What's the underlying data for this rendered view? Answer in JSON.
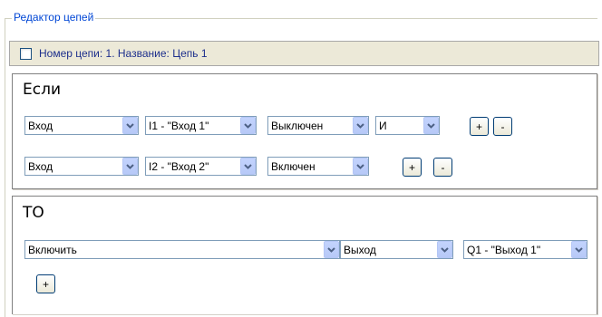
{
  "editor": {
    "title": "Редактор цепей",
    "chain_label": "Номер цепи: 1. Название: Цепь 1",
    "chain_checked": false
  },
  "if_section": {
    "title": "Если",
    "rows": [
      {
        "source": "Вход",
        "input": "I1 - \"Вход 1\"",
        "state": "Выключен",
        "logic": "И",
        "add": "+",
        "remove": "-"
      },
      {
        "source": "Вход",
        "input": "I2 - \"Вход 2\"",
        "state": "Включен",
        "add": "+",
        "remove": "-"
      }
    ]
  },
  "then_section": {
    "title": "ТО",
    "action": "Включить",
    "target_type": "Выход",
    "target": "Q1 - \"Выход 1\"",
    "add": "+"
  },
  "icons": {
    "combo": "chevron-down-icon"
  },
  "colors": {
    "legend": "#0046d5",
    "header_bg": "#ece9d8",
    "combo_border": "#7f9db9",
    "combo_button": "#c3d3fd"
  }
}
